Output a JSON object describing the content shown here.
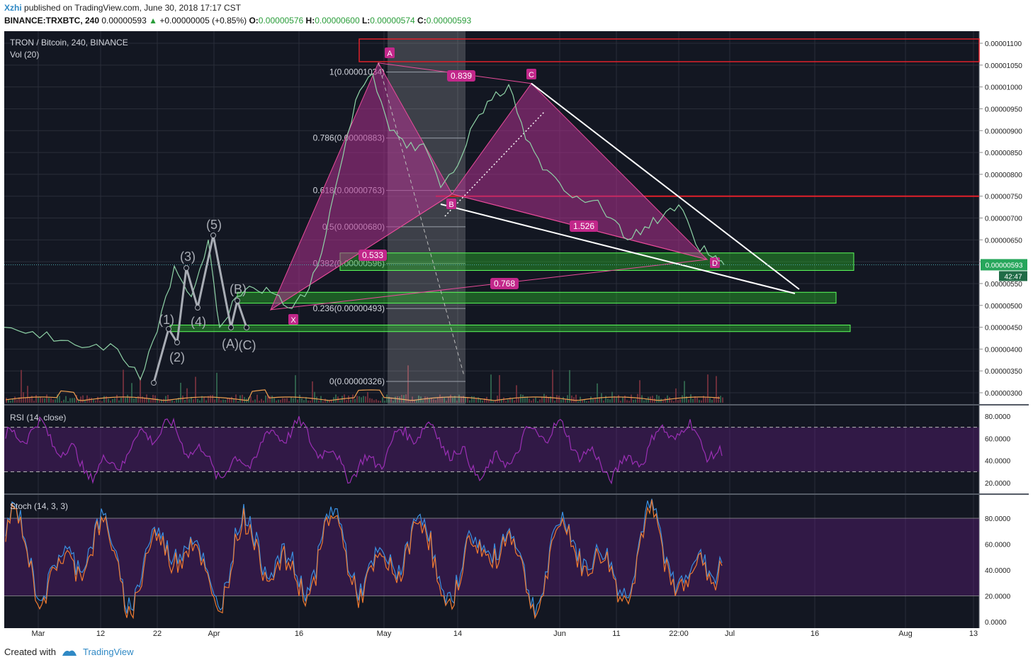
{
  "header": {
    "user": "Xzhi",
    "published": "published on TradingView.com, June 30, 2018 17:17 CST",
    "symbol_line": "BINANCE:TRXBTC, 240",
    "last": "0.00000593",
    "change": "+0.00000005 (+0.85%)",
    "o_label": "O:",
    "o": "0.00000576",
    "h_label": "H:",
    "h": "0.00000600",
    "l_label": "L:",
    "l": "0.00000574",
    "c_label": "C:",
    "c": "0.00000593"
  },
  "footer": {
    "created": "Created with",
    "brand": "TradingView"
  },
  "colors": {
    "background": "#131722",
    "pattern_fill": "#b0318f",
    "pattern_line": "#e84c9a",
    "zone_fill": "#2bb02b",
    "zone_border": "#5cff5c",
    "red_line": "#e0202a",
    "rsi": "#9b2fb5",
    "stoch_k": "#3a8fe0",
    "stoch_d": "#f07a30",
    "label_bg": "#c2278a",
    "last_price_bg": "#26a65b"
  },
  "chart_data": {
    "type": "line",
    "title": "TRON / Bitcoin, 240, BINANCE",
    "volume_label": "Vol (20)",
    "x_ticks": [
      "Mar",
      "12",
      "22",
      "Apr",
      "16",
      "May",
      "14",
      "Jun",
      "11",
      "22:00",
      "Jul",
      "16",
      "Aug",
      "13"
    ],
    "y_ticks": [
      "0.00001100",
      "0.00001050",
      "0.00001000",
      "0.00000950",
      "0.00000900",
      "0.00000850",
      "0.00000800",
      "0.00000750",
      "0.00000700",
      "0.00000650",
      "0.00000600",
      "0.00000550",
      "0.00000500",
      "0.00000450",
      "0.00000400",
      "0.00000350",
      "0.00000300"
    ],
    "last_price": "0.00000593",
    "countdown": "42:47",
    "series": [
      {
        "name": "TRXBTC",
        "x": [
          "2018-02-23",
          "2018-02-28",
          "2018-03-05",
          "2018-03-10",
          "2018-03-15",
          "2018-03-19",
          "2018-03-22",
          "2018-03-25",
          "2018-03-28",
          "2018-03-31",
          "2018-04-02",
          "2018-04-05",
          "2018-04-08",
          "2018-04-11",
          "2018-04-14",
          "2018-04-17",
          "2018-04-20",
          "2018-04-23",
          "2018-04-26",
          "2018-04-29",
          "2018-05-02",
          "2018-05-05",
          "2018-05-08",
          "2018-05-11",
          "2018-05-14",
          "2018-05-17",
          "2018-05-20",
          "2018-05-23",
          "2018-05-26",
          "2018-05-29",
          "2018-06-01",
          "2018-06-04",
          "2018-06-07",
          "2018-06-10",
          "2018-06-13",
          "2018-06-16",
          "2018-06-19",
          "2018-06-22",
          "2018-06-25",
          "2018-06-28",
          "2018-06-30"
        ],
        "y": [
          4.5e-06,
          4.4e-06,
          4.2e-06,
          4.05e-06,
          4e-06,
          3.3e-06,
          4.4e-06,
          5.9e-06,
          5.2e-06,
          6.5e-06,
          4.5e-06,
          5.2e-06,
          5.4e-06,
          5.3e-06,
          4.95e-06,
          5.2e-06,
          6.2e-06,
          8e-06,
          9.7e-06,
          1.03e-05,
          9e-06,
          8.6e-06,
          8.7e-06,
          7.7e-06,
          8.2e-06,
          9.2e-06,
          9.7e-06,
          1.005e-05,
          8.8e-06,
          8.1e-06,
          7.8e-06,
          7.5e-06,
          7.4e-06,
          7e-06,
          6.5e-06,
          6.8e-06,
          7e-06,
          7.3e-06,
          6.4e-06,
          6.1e-06,
          5.93e-06
        ]
      }
    ],
    "fib_levels": [
      {
        "label": "1(0.00001034)",
        "value": 1.034e-05
      },
      {
        "label": "0.786(0.00000883)",
        "value": 8.83e-06
      },
      {
        "label": "0.618(0.00000763)",
        "value": 7.63e-06
      },
      {
        "label": "0.5(0.00000680)",
        "value": 6.8e-06
      },
      {
        "label": "0.382(0.00000596)",
        "value": 5.96e-06
      },
      {
        "label": "0.236(0.00000493)",
        "value": 4.93e-06
      },
      {
        "label": "0(0.00000326)",
        "value": 3.26e-06
      }
    ],
    "pattern_points": {
      "X": {
        "x": "2018-04-11",
        "y": 4.9e-06
      },
      "A": {
        "x": "2018-04-30",
        "y": 1.055e-05
      },
      "B": {
        "x": "2018-05-13",
        "y": 7.55e-06
      },
      "C": {
        "x": "2018-05-27",
        "y": 1.008e-05
      },
      "D": {
        "x": "2018-06-27",
        "y": 6.05e-06
      }
    },
    "ratios": [
      "0.839",
      "0.533",
      "1.526",
      "0.768"
    ],
    "wave_labels": [
      "(1)",
      "(2)",
      "(3)",
      "(4)",
      "(5)",
      "(A)",
      "(B)",
      "(C)"
    ],
    "indicators": [
      {
        "name": "RSI (14, close)",
        "ticks": [
          "80.0000",
          "60.0000",
          "40.0000",
          "20.0000"
        ],
        "bands": [
          70,
          30
        ]
      },
      {
        "name": "Stoch (14, 3, 3)",
        "ticks": [
          "80.0000",
          "60.0000",
          "40.0000",
          "20.0000",
          "0.0000"
        ],
        "bands": [
          80,
          20
        ]
      }
    ]
  }
}
